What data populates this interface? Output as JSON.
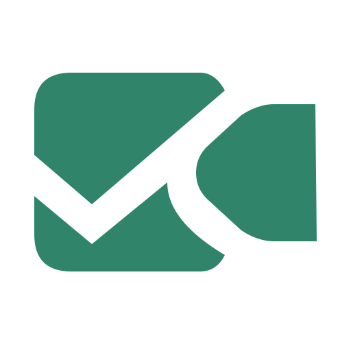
{
  "logo": {
    "name": "video-camera-check-logo",
    "icon": "video-camera-check-icon",
    "color": "#2f8469",
    "background": "#ffffff"
  }
}
